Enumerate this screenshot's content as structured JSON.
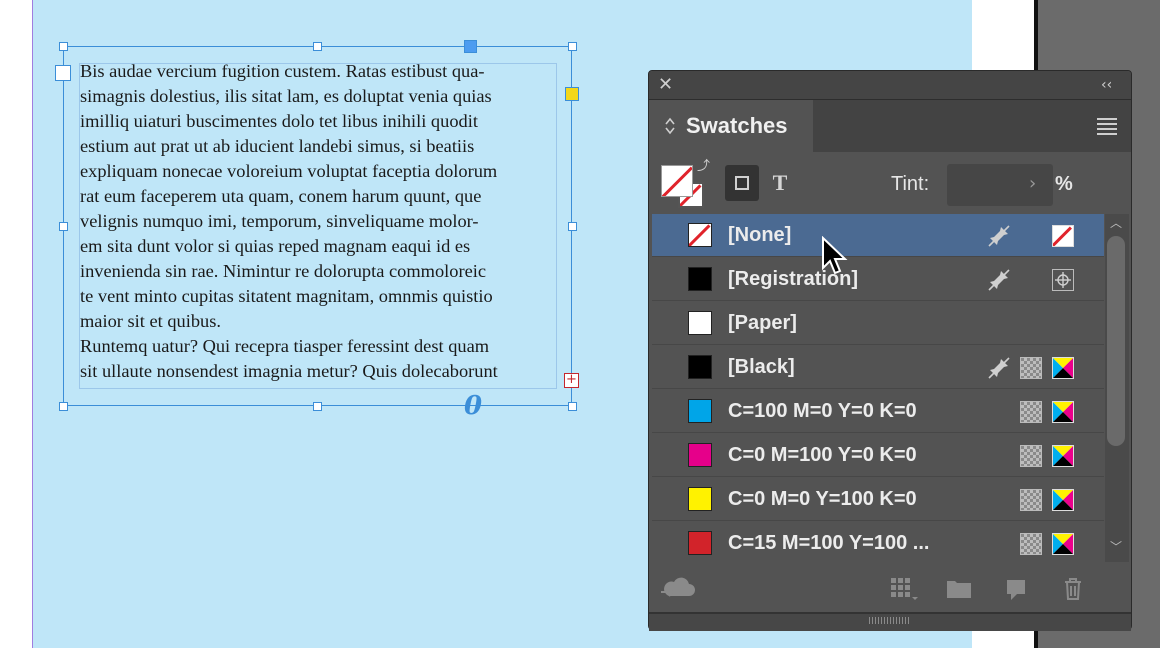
{
  "document": {
    "body_text_lines": [
      "Bis audae vercium fugition custem. Ratas estibust qua-",
      "simagnis dolestius, ilis sitat lam, es doluptat venia quias",
      "imilliq uiaturi buscimentes dolo tet libus inihili quodit",
      "estium aut prat ut ab iducient landebi simus, si beatiis",
      "expliquam nonecae voloreium voluptat faceptia dolorum",
      "rat eum faceperem uta quam, conem harum quunt, que",
      "velignis numquo imi, temporum, sinveliquame molor-",
      "em sita dunt volor si quias reped magnam eaqui id es",
      "invenienda sin rae. Nimintur re dolorupta commoloreic",
      "te vent minto cupitas sitatent magnitam, omnmis quistio",
      "maior sit et quibus.",
      "Runtemq uatur? Qui recepra tiasper feressint dest quam",
      "sit ullaute nonsendest imagnia metur? Quis dolecaborunt"
    ],
    "overset_marker": "+",
    "content_grabber_glyph": "0"
  },
  "panel": {
    "close_glyph": "✕",
    "collapse_glyph": "‹‹",
    "tab_arrows": "⌃⌄",
    "title": "Swatches",
    "tint_label": "Tint:",
    "tint_value": "",
    "tint_arrow": "›",
    "tint_unit": "%",
    "text_button_glyph": "T",
    "swap_glyph": "⤴",
    "scroll_up_glyph": "︿",
    "scroll_down_glyph": "﹀",
    "swatches": [
      {
        "name": "[None]",
        "color": "none",
        "selected": true,
        "non_editable": true,
        "mode": "none"
      },
      {
        "name": "[Registration]",
        "color": "#000000",
        "selected": false,
        "non_editable": true,
        "mode": "registration"
      },
      {
        "name": "[Paper]",
        "color": "#ffffff",
        "selected": false,
        "non_editable": false,
        "mode": ""
      },
      {
        "name": "[Black]",
        "color": "#000000",
        "selected": false,
        "non_editable": true,
        "mode": "process-cmyk"
      },
      {
        "name": "C=100 M=0 Y=0 K=0",
        "color": "#00a5e8",
        "selected": false,
        "non_editable": false,
        "mode": "process-cmyk"
      },
      {
        "name": "C=0 M=100 Y=0 K=0",
        "color": "#e6008a",
        "selected": false,
        "non_editable": false,
        "mode": "process-cmyk"
      },
      {
        "name": "C=0 M=0 Y=100 K=0",
        "color": "#fff200",
        "selected": false,
        "non_editable": false,
        "mode": "process-cmyk"
      },
      {
        "name": "C=15 M=100 Y=100 ...",
        "color": "#d2232a",
        "selected": false,
        "non_editable": false,
        "mode": "process-cmyk"
      }
    ],
    "bottom_icons": [
      "cc-libraries-icon",
      "swatch-views-icon",
      "new-color-group-icon",
      "new-swatch-icon",
      "delete-swatch-icon"
    ]
  },
  "colors": {
    "page": "#bfe6f8",
    "frame_edge": "#3b8ed8",
    "selection": "#4b6a92",
    "panel_bg": "#535353",
    "none_slash": "#e0232b"
  }
}
